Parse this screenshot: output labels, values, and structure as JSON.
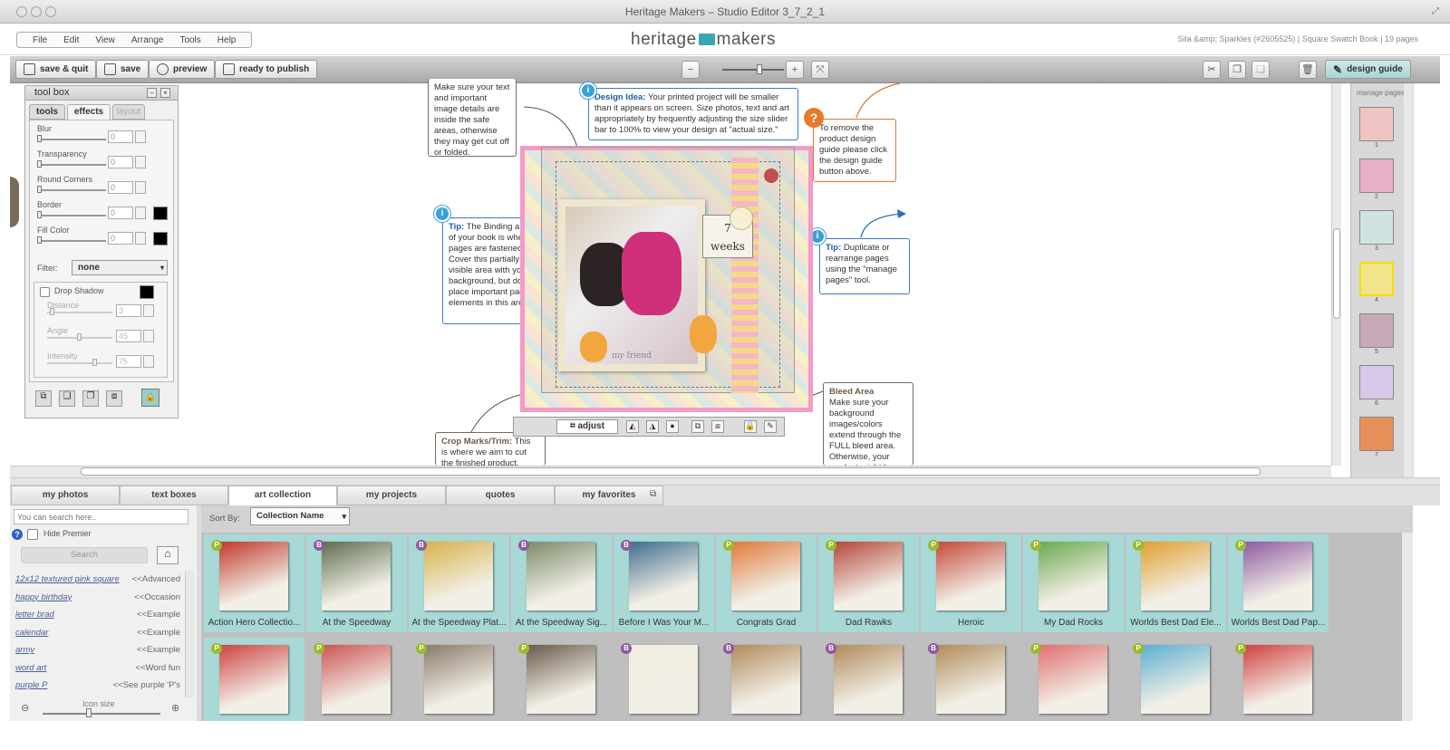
{
  "window": {
    "title": "Heritage Makers – Studio Editor 3_7_2_1"
  },
  "menu": [
    "File",
    "Edit",
    "View",
    "Arrange",
    "Tools",
    "Help"
  ],
  "logo": {
    "left": "heritage",
    "right": "makers"
  },
  "project_info": "Sila &amp; Sparkles (#2605525) | Square Swatch Book | 19 pages",
  "toolbar": {
    "save_quit": "save & quit",
    "save": "save",
    "preview": "preview",
    "ready": "ready to publish",
    "design_guide": "design guide"
  },
  "toolbox": {
    "title": "tool box",
    "tabs": [
      "tools",
      "effects",
      "layout"
    ],
    "fields": [
      {
        "label": "Blur",
        "value": "0",
        "swatch": false,
        "level": 0
      },
      {
        "label": "Transparency",
        "value": "0",
        "swatch": false,
        "level": 0
      },
      {
        "label": "Round Corners",
        "value": "0",
        "swatch": false,
        "level": 0
      },
      {
        "label": "Border",
        "value": "0",
        "swatch": true,
        "level": 0
      },
      {
        "label": "Fill Color",
        "value": "0",
        "swatch": true,
        "level": 0
      }
    ],
    "filter_label": "Filter:",
    "filter_value": "none",
    "drop_shadow": "Drop Shadow",
    "shadow_fields": [
      {
        "label": "Distance",
        "value": "3",
        "level": 0.05
      },
      {
        "label": "Angle",
        "value": "45",
        "level": 0.5
      },
      {
        "label": "Intensity",
        "value": "75",
        "level": 0.75
      }
    ]
  },
  "notes": {
    "safe": "Make sure your text and important image details are inside the safe areas, otherwise they may get cut off or folded.",
    "idea_title": "Design Idea:",
    "idea": "Your printed project will be smaller than it appears on screen. Size photos, text and art appropriately by frequently adjusting the size slider bar to 100% to view your design at \"actual size.\"",
    "guide": "To remove the product design guide please click the design guide button above.",
    "tip1_title": "Tip:",
    "tip1": "The Binding area of your book is where pages are fastened. Cover this partially visible area with your background, but do not place important page elements in this area.",
    "tip2_title": "Tip:",
    "tip2": "Duplicate or rearrange pages using the \"manage pages\" tool.",
    "bleed_title": "Bleed Area",
    "bleed": "Make sure your background images/colors extend through the FULL bleed area. Otherwise, your product might have white edges.",
    "crop_title": "Crop Marks/Trim:",
    "crop": "This is where we aim to cut the finished product."
  },
  "page_art": {
    "tag_number": "7",
    "tag_word": "weeks",
    "caption": "my friend"
  },
  "adjust_label": "adjust",
  "manage_pages": {
    "title": "manage pages",
    "pages": [
      "1",
      "2",
      "3",
      "4",
      "5",
      "6",
      "7"
    ]
  },
  "bottom_tabs": [
    "my photos",
    "text boxes",
    "art collection",
    "my projects",
    "quotes",
    "my favorites"
  ],
  "search": {
    "placeholder": "You can search here..",
    "hide_premier": "Hide Premier",
    "button": "Search",
    "results": [
      {
        "term": "12x12 textured pink square",
        "category": "<<Advanced"
      },
      {
        "term": "happy birthday",
        "category": "<<Occasion"
      },
      {
        "term": "letter brad",
        "category": "<<Example"
      },
      {
        "term": "calendar",
        "category": "<<Example"
      },
      {
        "term": "army",
        "category": "<<Example"
      },
      {
        "term": "word art",
        "category": "<<Word fun"
      },
      {
        "term": "purple P",
        "category": "<<See purple 'P's"
      }
    ],
    "icon_size": "Icon size"
  },
  "sort": {
    "label": "Sort By:",
    "value": "Collection Name"
  },
  "collections_row1": [
    {
      "name": "Action Hero Collectio...",
      "badge": "P",
      "color": "#c0392b"
    },
    {
      "name": "At the Speedway",
      "badge": "B",
      "color": "#5d6d4e"
    },
    {
      "name": "At the Speedway Plat...",
      "badge": "B",
      "color": "#d8b24a"
    },
    {
      "name": "At the Speedway Sig...",
      "badge": "B",
      "color": "#7a8a6a"
    },
    {
      "name": "Before I Was Your M...",
      "badge": "B",
      "color": "#3f6c8c"
    },
    {
      "name": "Congrats Grad",
      "badge": "P",
      "color": "#e07a3a"
    },
    {
      "name": "Dad Rawks",
      "badge": "P",
      "color": "#b5463a"
    },
    {
      "name": "Heroic",
      "badge": "P",
      "color": "#c4493a"
    },
    {
      "name": "My Dad Rocks",
      "badge": "P",
      "color": "#6aa84f"
    },
    {
      "name": "Worlds Best Dad Ele...",
      "badge": "P",
      "color": "#e0a030"
    },
    {
      "name": "Worlds Best Dad Pap...",
      "badge": "P",
      "color": "#8e5aa0"
    }
  ],
  "collections_row2": [
    {
      "badge": "P",
      "color": "#c44"
    },
    {
      "badge": "P",
      "color": "#c55"
    },
    {
      "badge": "P",
      "color": "#8a7a6a"
    },
    {
      "badge": "P",
      "color": "#6a5a4a"
    },
    {
      "badge": "B",
      "color": "#f1ede0"
    },
    {
      "badge": "B",
      "color": "#b08b5b"
    },
    {
      "badge": "B",
      "color": "#b08b5b"
    },
    {
      "badge": "B",
      "color": "#b08b5b"
    },
    {
      "badge": "P",
      "color": "#e07070"
    },
    {
      "badge": "P",
      "color": "#5ab0d0"
    },
    {
      "badge": "P",
      "color": "#d04040"
    }
  ],
  "colors": {
    "accent": "#3aa8b0",
    "card": "#a8d9d6",
    "premier_badge": "#9bbb2a",
    "basic_badge": "#8e5aa0"
  }
}
